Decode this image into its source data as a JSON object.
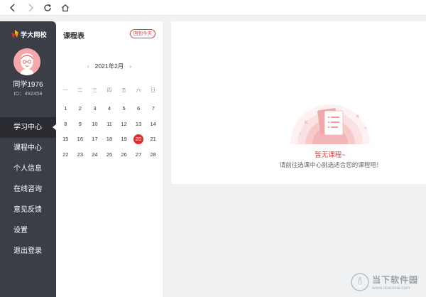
{
  "browser": {
    "back_icon": "chevron-left-icon",
    "forward_icon": "chevron-right-icon",
    "refresh_icon": "refresh-icon",
    "home_icon": "home-icon"
  },
  "sidebar": {
    "brand": "学大网校",
    "username": "同学1976",
    "user_id": "ID：492458",
    "items": [
      {
        "label": "学习中心",
        "active": true
      },
      {
        "label": "课程中心"
      },
      {
        "label": "个人信息"
      },
      {
        "label": "在线咨询"
      },
      {
        "label": "意见反馈"
      },
      {
        "label": "设置"
      },
      {
        "label": "退出登录"
      }
    ]
  },
  "calendar": {
    "title": "课程表",
    "back_today": "回到今天",
    "prev": "‹",
    "month": "2021年2月",
    "next": "›",
    "weekdays": [
      "一",
      "二",
      "三",
      "四",
      "五",
      "六",
      "日"
    ],
    "weeks": [
      [
        "1",
        "2",
        "3",
        "4",
        "5",
        "6",
        "7"
      ],
      [
        "8",
        "9",
        "10",
        "11",
        "12",
        "13",
        "14"
      ],
      [
        "15",
        "16",
        "17",
        "18",
        "19",
        "20",
        "21"
      ],
      [
        "22",
        "23",
        "24",
        "25",
        "26",
        "27",
        "28"
      ]
    ],
    "today": "20"
  },
  "main": {
    "empty_title": "暂无课程~",
    "empty_desc": "请前往选课中心挑选适合您的课程吧！"
  },
  "watermark": {
    "name": "当下软件园",
    "url": "www.downxia.com"
  },
  "colors": {
    "accent": "#e02c2c",
    "sidebar_bg": "#3b3e46",
    "sidebar_active": "#2a2c32"
  }
}
